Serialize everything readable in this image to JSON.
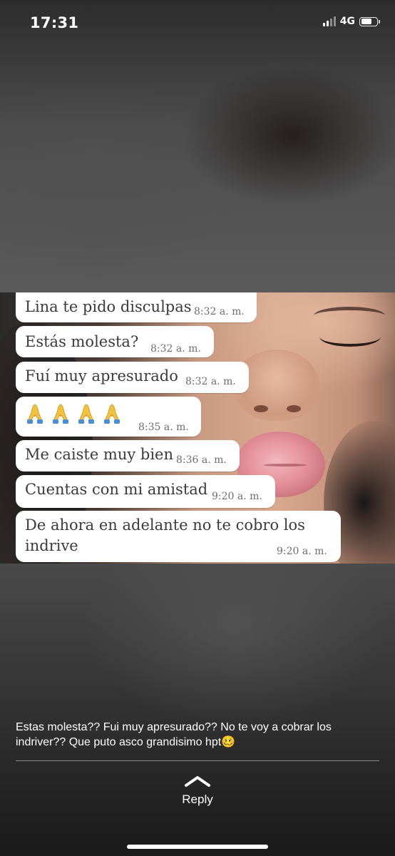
{
  "status_bar": {
    "time": "17:31",
    "network": "4G",
    "signal_bars_active": 2,
    "signal_bars_total": 4,
    "battery_level": 0.7
  },
  "messages": [
    {
      "text": "Lina te pido disculpas",
      "time": "8:32 a. m."
    },
    {
      "text": "Estás molesta?",
      "time": "8:32 a. m."
    },
    {
      "text": "Fuí  muy apresurado",
      "time": "8:32 a. m."
    },
    {
      "text": "🙏🙏🙏🙏",
      "time": "8:35 a. m."
    },
    {
      "text": "Me caiste muy bien",
      "time": "8:36 a. m."
    },
    {
      "text": "Cuentas con mi amistad",
      "time": "9:20 a. m."
    },
    {
      "text_line1": "De ahora en adelante no te cobro los",
      "text_line2": "indrive",
      "time": "9:20 a. m."
    }
  ],
  "caption": "Estas molesta?? Fui muy apresurado?? No te voy a cobrar los indriver?? Que puto asco grandisimo hpt🥴",
  "reply": {
    "label": "Reply",
    "icon": "chevron-up-icon"
  },
  "colors": {
    "bubble": "#ffffff",
    "bubble_text": "#3b3b3b",
    "timestamp": "#6e6e6e"
  }
}
